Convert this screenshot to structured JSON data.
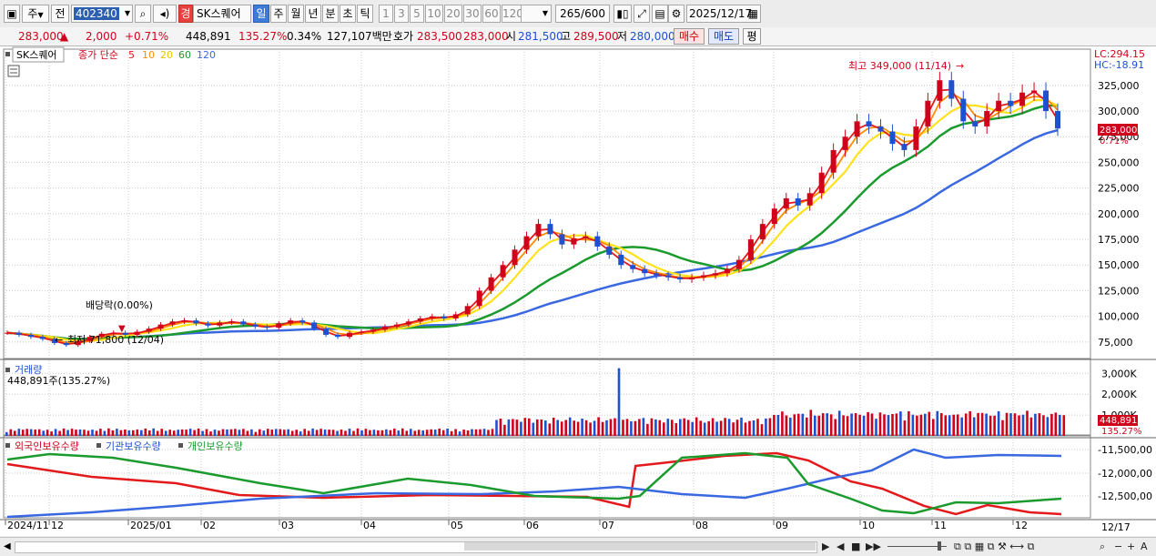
{
  "toolbar": {
    "type_label": "주",
    "prev_label": "전",
    "code": "402340",
    "kyung_badge": "경",
    "stock_name": "SK스퀘어",
    "periods": [
      "일",
      "주",
      "월",
      "년",
      "분",
      "초",
      "틱"
    ],
    "active_period": "일",
    "minute_options": [
      "1",
      "3",
      "5",
      "10",
      "20",
      "30",
      "60",
      "120"
    ],
    "count": "265",
    "count_total": "/600",
    "date": "2025/12/17"
  },
  "infobar": {
    "price": "283,000",
    "change": "2,000",
    "change_pct": "+0.71%",
    "volume": "448,891",
    "vol_ratio": "135.27%",
    "turnover": "0.34%",
    "trade_value": "127,107백만",
    "hoga_label": "호가",
    "hoga_ask": "283,500",
    "hoga_bid": "283,000",
    "open_label": "시",
    "open": "281,500",
    "high_label": "고",
    "high": "289,500",
    "low_label": "저",
    "low": "280,000",
    "buy_button": "매수",
    "sell_button": "매도",
    "eval_button": "평"
  },
  "colors": {
    "up": "#d0021b",
    "down": "#1e50d0",
    "ma5": "#e31a1c",
    "ma10": "#ff8c00",
    "ma20": "#ffe21a",
    "ma60": "#1b9a2e",
    "ma120": "#3a68e0"
  },
  "chart_data": [
    {
      "type": "candlestick",
      "legend": {
        "name": "SK스퀘어",
        "label": "종가 단순",
        "periods": [
          "5",
          "10",
          "20",
          "60",
          "120"
        ]
      },
      "right_labels": {
        "lc": "LC:294.15",
        "hc": "HC:-18.91"
      },
      "price_tag": "283,000",
      "pct_tag": "0.71%",
      "y_ticks": [
        "325,000",
        "300,000",
        "275,000",
        "250,000",
        "225,000",
        "200,000",
        "175,000",
        "150,000",
        "125,000",
        "100,000",
        "75,000"
      ],
      "ylim": [
        58000,
        355000
      ],
      "annotations": {
        "high": "최고 349,000 (11/14)",
        "low": "최저 71,800 (12/04)",
        "dividend": "배당락(0.00%)"
      },
      "x_labels": [
        "2024/11",
        "12",
        "2025/01",
        "02",
        "03",
        "04",
        "05",
        "06",
        "07",
        "08",
        "09",
        "10",
        "11",
        "12"
      ],
      "last_date": "12/17",
      "close_points": [
        84000,
        82000,
        80000,
        78000,
        74000,
        72000,
        76000,
        80000,
        83000,
        84000,
        82000,
        85000,
        88000,
        92000,
        95000,
        96000,
        93000,
        91000,
        94000,
        95000,
        92000,
        90000,
        89000,
        93000,
        96000,
        94000,
        88000,
        82000,
        80000,
        84000,
        85000,
        87000,
        90000,
        92000,
        95000,
        98000,
        100000,
        98000,
        102000,
        110000,
        125000,
        138000,
        150000,
        165000,
        178000,
        190000,
        180000,
        170000,
        176000,
        178000,
        168000,
        160000,
        150000,
        146000,
        142000,
        140000,
        138000,
        136000,
        138000,
        140000,
        142000,
        146000,
        155000,
        175000,
        190000,
        205000,
        215000,
        208000,
        220000,
        240000,
        262000,
        275000,
        290000,
        285000,
        280000,
        268000,
        262000,
        285000,
        310000,
        330000,
        312000,
        290000,
        285000,
        300000,
        310000,
        305000,
        318000,
        320000,
        300000,
        283000
      ]
    },
    {
      "type": "bar",
      "legend": "거래량",
      "info": "448,891주(135.27%)",
      "y_ticks": [
        "3,000K",
        "2,000K",
        "1,000K"
      ],
      "ylim": [
        0,
        3450
      ],
      "value_tag": "448,891",
      "pct_tag": "135.27%"
    },
    {
      "type": "line",
      "legend": [
        "외국인보유수량",
        "기관보유수량",
        "개인보유수량"
      ],
      "y_ticks": [
        "-11,500,00",
        "-12,000,00",
        "-12,500,00"
      ]
    }
  ],
  "statusbar": {
    "nav": [
      "▶",
      "◀",
      "■",
      "▶▶"
    ],
    "zoom_out": "−",
    "zoom_in": "+",
    "font_a": "A"
  }
}
